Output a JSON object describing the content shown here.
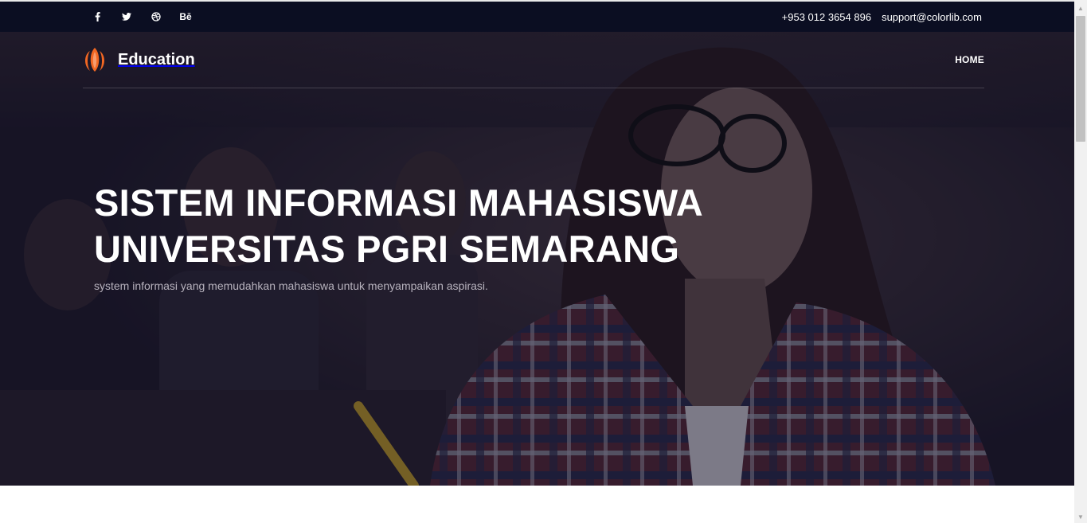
{
  "topbar": {
    "social": [
      {
        "icon": "facebook-icon",
        "glyph": "f"
      },
      {
        "icon": "twitter-icon",
        "glyph": "🐦"
      },
      {
        "icon": "dribbble-icon",
        "glyph": "⊛"
      },
      {
        "icon": "behance-icon",
        "glyph": "Bē"
      }
    ],
    "phone": "+953 012 3654 896",
    "email": "support@colorlib.com"
  },
  "header": {
    "brand": "Education",
    "nav": {
      "home": "HOME"
    }
  },
  "hero": {
    "title_line1": "SISTEM INFORMASI MAHASISWA",
    "title_line2": "UNIVERSITAS PGRI SEMARANG",
    "subtitle": "system informasi yang memudahkan mahasiswa untuk menyampaikan aspirasi."
  },
  "colors": {
    "topbar": "#0b0e22",
    "accent": "#f26722",
    "text": "#ffffff"
  }
}
